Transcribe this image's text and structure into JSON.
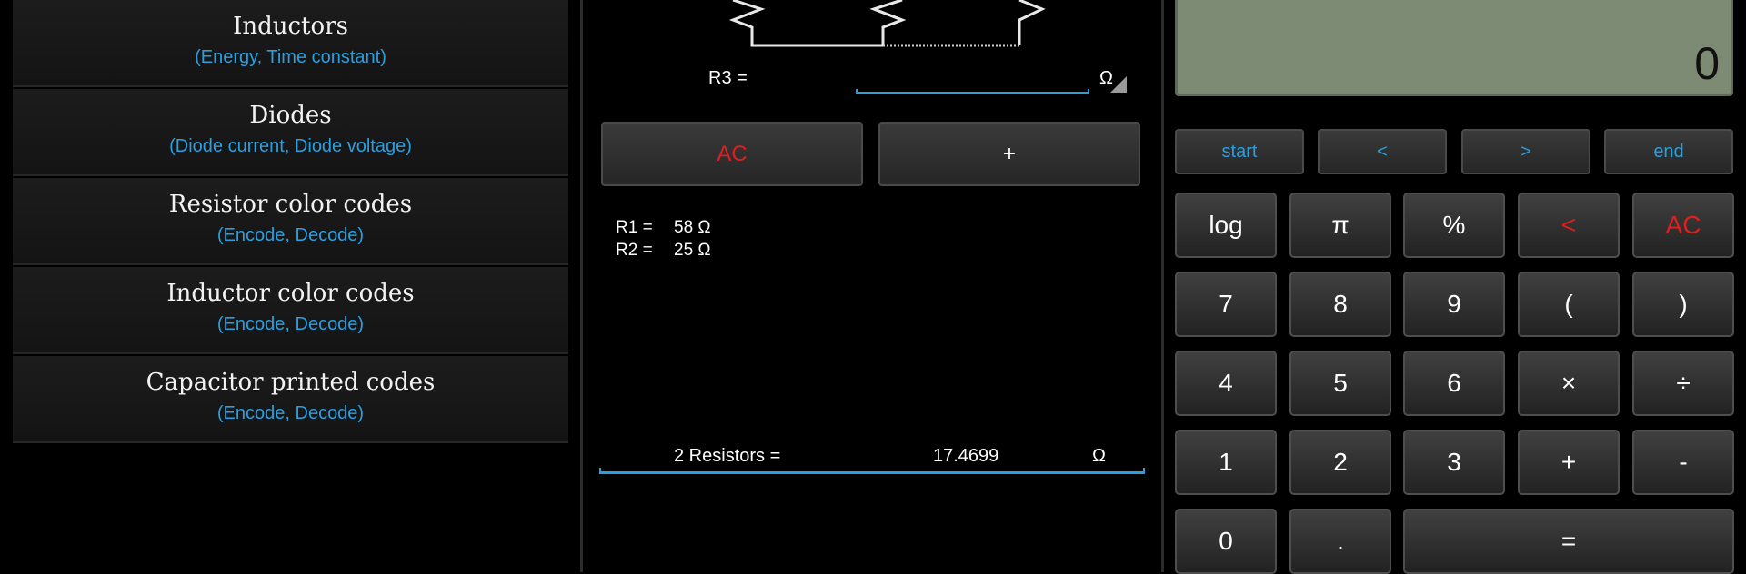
{
  "menu": {
    "items": [
      {
        "title": "Inductors",
        "subtitle": "(Energy, Time constant)"
      },
      {
        "title": "Diodes",
        "subtitle": "(Diode current, Diode voltage)"
      },
      {
        "title": "Resistor color codes",
        "subtitle": "(Encode, Decode)"
      },
      {
        "title": "Inductor color codes",
        "subtitle": "(Encode, Decode)"
      },
      {
        "title": "Capacitor printed codes",
        "subtitle": "(Encode, Decode)"
      }
    ]
  },
  "resistors": {
    "r3_label": "R3 =",
    "r3_value": "",
    "r3_unit": "Ω",
    "clear_label": "AC",
    "add_label": "+",
    "entries": [
      {
        "name": "R1 =",
        "value": "58 Ω"
      },
      {
        "name": "R2 =",
        "value": "25 Ω"
      }
    ],
    "result_label": "2 Resistors =",
    "result_value": "17.4699",
    "result_unit": "Ω"
  },
  "calculator": {
    "display": "0",
    "nav": [
      "start",
      "<",
      ">",
      "end"
    ],
    "rows": [
      [
        "log",
        "π",
        "%",
        "<",
        "AC"
      ],
      [
        "7",
        "8",
        "9",
        "(",
        ")"
      ],
      [
        "4",
        "5",
        "6",
        "×",
        "÷"
      ],
      [
        "1",
        "2",
        "3",
        "+",
        "-"
      ],
      [
        "0",
        ".",
        "="
      ]
    ]
  },
  "colors": {
    "accent": "#2a9fe0",
    "danger": "#e01e1e",
    "lcd": "#7d8a74"
  }
}
